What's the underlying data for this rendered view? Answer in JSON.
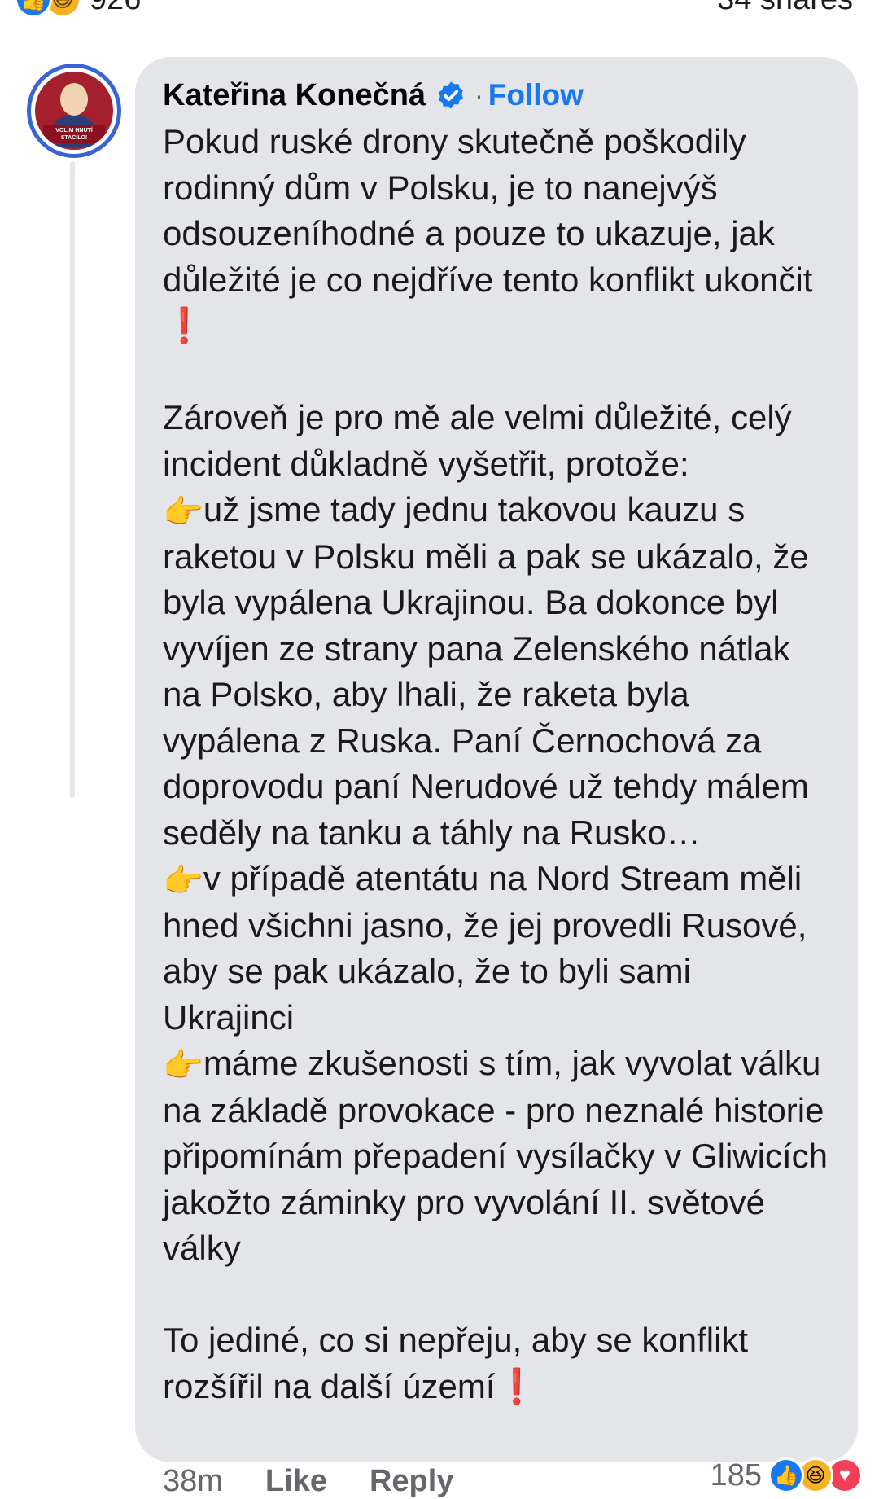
{
  "reactions": {
    "count": "926",
    "icons": [
      "like-icon",
      "haha-icon"
    ],
    "shares": "34 shares"
  },
  "comment": {
    "author": "Kateřina Konečná",
    "verified": true,
    "follow_label": "Follow",
    "separator": "·",
    "avatar_banner_line1": "VOLÍM HNUTÍ",
    "avatar_banner_line2": "STAČILO!",
    "paragraphs": [
      "Pokud ruské drony skutečně poškodily rodinný dům v Polsku, je to nanejvýš odsouzeníhodné a pouze to ukazuje, jak důležité je co nejdříve tento konflikt ukončit",
      "Zároveň je pro mě ale velmi důležité, celý incident důkladně vyšetřit, protože:",
      "už jsme tady jednu takovou kauzu s raketou v Polsku měli a pak se ukázalo, že byla vypálena Ukrajinou. Ba dokonce byl vyvíjen ze strany pana Zelenského nátlak na Polsko, aby lhali, že raketa byla vypálena z Ruska. Paní Černochová za doprovodu paní Nerudové už tehdy málem seděly na tanku a táhly na Rusko…",
      "v případě atentátu na Nord Stream měli hned všichni jasno, že jej provedli Rusové, aby se pak ukázalo, že to byli sami Ukrajinci",
      "máme zkušenosti s tím, jak vyvolat válku na základě provokace - pro neznalé historie připomínám přepadení vysílačky v Gliwicích jakožto záminky pro vyvolání II. světové války",
      "To jediné, co si nepřeju, aby se konflikt rozšířil na další území"
    ],
    "emoji_exclamation": "❗",
    "emoji_point": "👉"
  },
  "actions": {
    "time": "38m",
    "like_label": "Like",
    "reply_label": "Reply",
    "reaction_count": "185",
    "reaction_icons": [
      "like-icon",
      "haha-icon",
      "love-icon"
    ]
  },
  "colors": {
    "accent": "#1877f2",
    "bubble": "#e4e5e9",
    "avatar_ring": "#3a64d6",
    "exclamation": "#e0282b"
  }
}
